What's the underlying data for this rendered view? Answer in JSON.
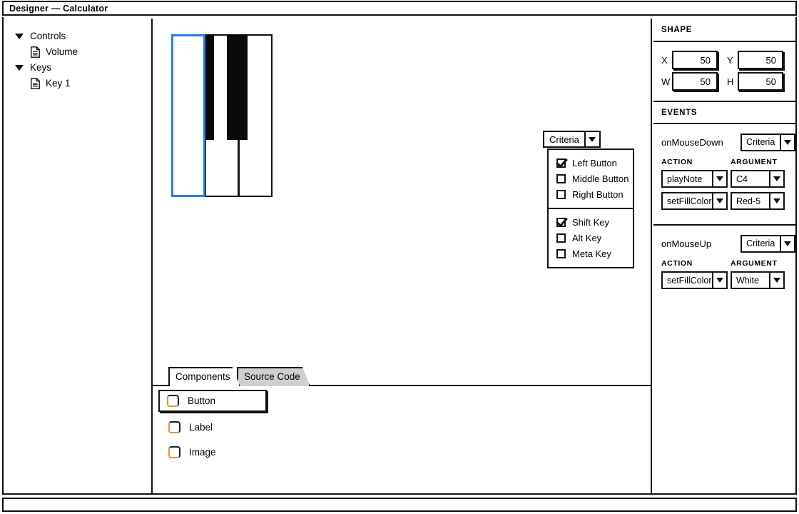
{
  "window": {
    "title": "Designer — Calculator"
  },
  "sidebar": {
    "items": [
      {
        "label": "Controls",
        "type": "group",
        "icon": "caret-down-icon"
      },
      {
        "label": "Volume",
        "type": "leaf",
        "icon": "document-icon"
      },
      {
        "label": "Keys",
        "type": "group",
        "icon": "caret-down-icon"
      },
      {
        "label": "Key 1",
        "type": "leaf",
        "icon": "document-icon"
      }
    ]
  },
  "canvas": {
    "piano": {
      "white_keys": [
        "white-key-1",
        "white-key-2",
        "white-key-3"
      ],
      "black_keys": [
        "black-key-1",
        "black-key-2"
      ],
      "selected_key": "white-key-1",
      "selection_color": "#2b7ce8"
    },
    "criteria_popup": {
      "button_label": "Criteria",
      "groups": [
        {
          "options": [
            {
              "label": "Left Button",
              "checked": true
            },
            {
              "label": "Middle Button",
              "checked": false
            },
            {
              "label": "Right Button",
              "checked": false
            }
          ]
        },
        {
          "options": [
            {
              "label": "Shift Key",
              "checked": true
            },
            {
              "label": "Alt Key",
              "checked": false
            },
            {
              "label": "Meta Key",
              "checked": false
            }
          ]
        }
      ]
    },
    "tabs": [
      {
        "label": "Components",
        "active": true
      },
      {
        "label": "Source Code",
        "active": false
      }
    ],
    "palette": [
      {
        "label": "Button",
        "icon": "component-icon",
        "selected": true
      },
      {
        "label": "Label",
        "icon": "component-icon",
        "selected": false
      },
      {
        "label": "Image",
        "icon": "component-icon",
        "selected": false
      }
    ]
  },
  "properties": {
    "shape": {
      "heading": "SHAPE",
      "fields": [
        {
          "label": "X",
          "value": "50"
        },
        {
          "label": "Y",
          "value": "50"
        },
        {
          "label": "W",
          "value": "50"
        },
        {
          "label": "H",
          "value": "50"
        }
      ]
    },
    "events": {
      "heading": "EVENTS",
      "column_headers": {
        "action": "ACTION",
        "argument": "ARGUMENT"
      },
      "blocks": [
        {
          "name": "onMouseDown",
          "criteria_label": "Criteria",
          "rows": [
            {
              "action": "playNote",
              "argument": "C4"
            },
            {
              "action": "setFillColor",
              "argument": "Red-5"
            }
          ]
        },
        {
          "name": "onMouseUp",
          "criteria_label": "Criteria",
          "rows": [
            {
              "action": "setFillColor",
              "argument": "White"
            }
          ]
        }
      ]
    }
  }
}
